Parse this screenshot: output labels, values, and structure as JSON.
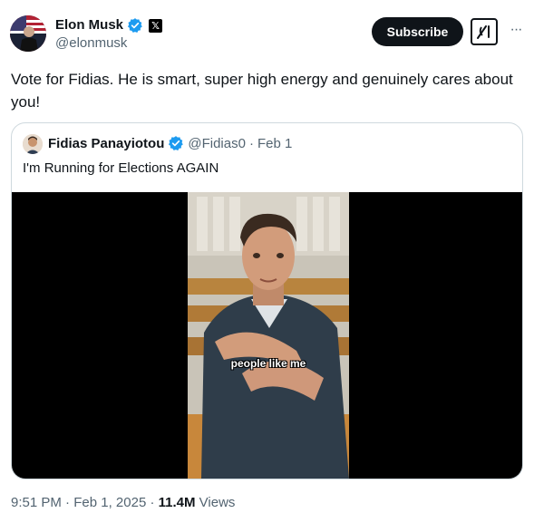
{
  "author": {
    "display_name": "Elon Musk",
    "handle": "@elonmusk",
    "verified_icon": "verified-badge-icon",
    "affiliate_icon": "x-logo-icon"
  },
  "actions": {
    "subscribe_label": "Subscribe",
    "grok_icon": "grok-icon",
    "more_icon": "more-options-icon",
    "more_label": "···"
  },
  "tweet": {
    "text": "Vote for Fidias. He is smart, super high energy and genuinely cares about you!"
  },
  "quote": {
    "display_name": "Fidias Panayiotou",
    "handle": "@Fidias0",
    "separator": "·",
    "date": "Feb 1",
    "text": "I'm Running for Elections AGAIN",
    "video_caption": "people like me"
  },
  "footer": {
    "time": "9:51 PM",
    "separator": "·",
    "date": "Feb 1, 2025",
    "views_count": "11.4M",
    "views_label": "Views"
  },
  "colors": {
    "text_primary": "#0f1419",
    "text_secondary": "#536471",
    "verified_blue": "#1d9bf0",
    "border": "#cfd9de"
  }
}
